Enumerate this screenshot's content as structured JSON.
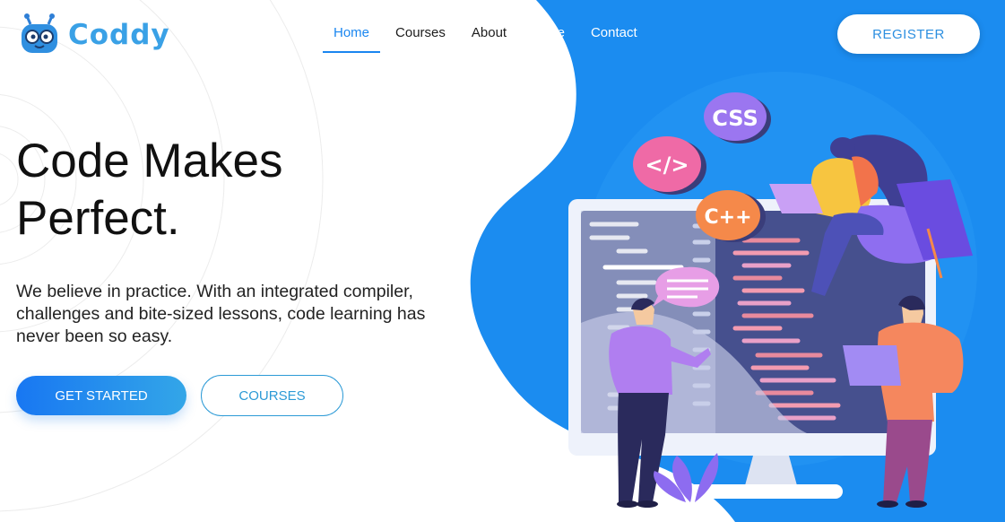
{
  "brand": {
    "name": "Coddy"
  },
  "nav": {
    "items": [
      {
        "label": "Home",
        "active": true
      },
      {
        "label": "Courses",
        "active": false
      },
      {
        "label": "About",
        "active": false
      },
      {
        "label": "Store",
        "active": false
      },
      {
        "label": "Contact",
        "active": false
      }
    ]
  },
  "header": {
    "register_label": "REGISTER"
  },
  "hero": {
    "title_line1": "Code Makes",
    "title_line2": "Perfect.",
    "description": "We believe in practice. With an integrated compiler, challenges and bite-sized lessons, code learning has never been so easy.",
    "primary_button": "GET STARTED",
    "secondary_button": "COURSES"
  },
  "illustration": {
    "bubbles": [
      "CSS",
      "</>",
      "C++"
    ]
  },
  "colors": {
    "accent": "#1a86f0",
    "blue_bg": "#1b8cf0",
    "text_dark": "#111111"
  }
}
